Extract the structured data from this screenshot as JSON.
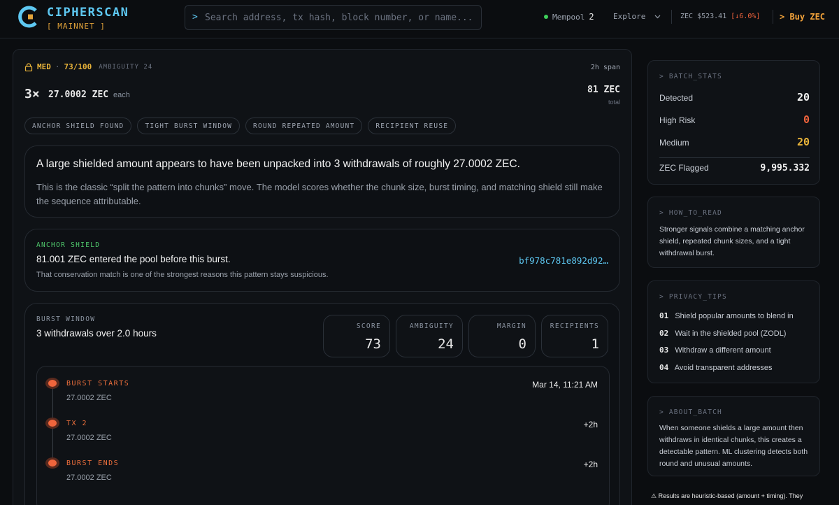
{
  "header": {
    "brand_name": "CIPHERSCAN",
    "network": "[ MAINNET ]",
    "search_prompt": ">",
    "search_placeholder": "Search address, tx hash, block number, or name...",
    "mempool_label": "Mempool",
    "mempool_count": "2",
    "explore_label": "Explore",
    "price_label": "ZEC $523.41",
    "price_change": "[↓6.0%]",
    "buy_label": "> Buy ZEC",
    "accent_color": "#5ec8f2",
    "brand_secondary_color": "#e2a33a"
  },
  "pattern": {
    "risk_level": "MED",
    "risk_score": "73/100",
    "ambiguity_label": "AMBIGUITY 24",
    "span": "2h span",
    "count": "3×",
    "amount": "27.0002 ZEC",
    "each_label": "each",
    "total_value": "81 ZEC",
    "total_label": "total",
    "tags": [
      "ANCHOR SHIELD FOUND",
      "TIGHT BURST WINDOW",
      "ROUND REPEATED AMOUNT",
      "RECIPIENT REUSE"
    ],
    "summary_heading": "A large shielded amount appears to have been unpacked into 3 withdrawals of roughly 27.0002 ZEC.",
    "summary_body": "This is the classic “split the pattern into chunks” move. The model scores whether the chunk size, burst timing, and matching shield still make the sequence attributable.",
    "anchor": {
      "label": "ANCHOR SHIELD",
      "heading": "81.001 ZEC entered the pool before this burst.",
      "subtext": "That conservation match is one of the strongest reasons this pattern stays suspicious.",
      "hash": "bf978c781e892d92…"
    },
    "burst": {
      "label": "BURST WINDOW",
      "heading": "3 withdrawals over 2.0 hours",
      "stats": [
        {
          "label": "SCORE",
          "value": "73"
        },
        {
          "label": "AMBIGUITY",
          "value": "24"
        },
        {
          "label": "MARGIN",
          "value": "0"
        },
        {
          "label": "RECIPIENTS",
          "value": "1"
        }
      ],
      "timeline": [
        {
          "title": "BURST STARTS",
          "amount": "27.0002 ZEC",
          "time": "Mar 14, 11:21 AM"
        },
        {
          "title": "TX 2",
          "amount": "27.0002 ZEC",
          "time": "+2h"
        },
        {
          "title": "BURST ENDS",
          "amount": "27.0002 ZEC",
          "time": "+2h"
        }
      ]
    }
  },
  "sidebar": {
    "batch_stats": {
      "heading": "> BATCH_STATS",
      "rows": [
        {
          "label": "Detected",
          "value": "20",
          "color": "#f2f2f2"
        },
        {
          "label": "High Risk",
          "value": "0",
          "color": "#f0633c"
        },
        {
          "label": "Medium",
          "value": "20",
          "color": "#e9b43a"
        },
        {
          "label": "ZEC Flagged",
          "value": "9,995.332",
          "color": "#f2f2f2"
        }
      ]
    },
    "how_to_read": {
      "heading": "> HOW_TO_READ",
      "body": "Stronger signals combine a matching anchor shield, repeated chunk sizes, and a tight withdrawal burst."
    },
    "privacy_tips": {
      "heading": "> PRIVACY_TIPS",
      "items": [
        {
          "num": "01",
          "text": "Shield popular amounts to blend in"
        },
        {
          "num": "02",
          "text": "Wait in the shielded pool (ZODL)"
        },
        {
          "num": "03",
          "text": "Withdraw a different amount"
        },
        {
          "num": "04",
          "text": "Avoid transparent addresses"
        }
      ]
    },
    "about_batch": {
      "heading": "> ABOUT_BATCH",
      "body": "When someone shields a large amount then withdraws in identical chunks, this creates a detectable pattern. ML clustering detects both round and unusual amounts."
    },
    "disclaimer": "⚠ Results are heuristic-based (amount + timing). They"
  }
}
